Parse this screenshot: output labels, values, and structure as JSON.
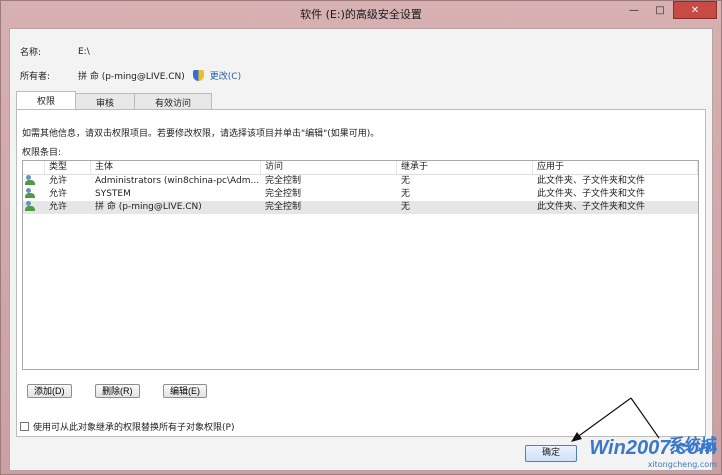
{
  "window": {
    "title": "软件 (E:)的高级安全设置",
    "controls": {
      "minimize": "—",
      "maximize": "□",
      "close": "✕"
    }
  },
  "info": {
    "name_label": "名称:",
    "name_value": "E:\\",
    "owner_label": "所有者:",
    "owner_value": "拼 命 (p-ming@LIVE.CN)",
    "change_link": "更改(C)"
  },
  "tabs": [
    {
      "label": "权限",
      "active": true
    },
    {
      "label": "审核",
      "active": false
    },
    {
      "label": "有效访问",
      "active": false
    }
  ],
  "panel": {
    "hint": "如需其他信息，请双击权限项目。若要修改权限，请选择该项目并单击\"编辑\"(如果可用)。",
    "entries_label": "权限条目:",
    "columns": [
      "类型",
      "主体",
      "访问",
      "继承于",
      "应用于"
    ],
    "rows": [
      {
        "type": "允许",
        "principal": "Administrators (win8china-pc\\Adm...",
        "access": "完全控制",
        "inherited": "无",
        "applies": "此文件夹、子文件夹和文件",
        "icon": "group-icon"
      },
      {
        "type": "允许",
        "principal": "SYSTEM",
        "access": "完全控制",
        "inherited": "无",
        "applies": "此文件夹、子文件夹和文件",
        "icon": "group-icon"
      },
      {
        "type": "允许",
        "principal": "拼 命 (p-ming@LIVE.CN)",
        "access": "完全控制",
        "inherited": "无",
        "applies": "此文件夹、子文件夹和文件",
        "icon": "user-icon"
      }
    ]
  },
  "buttons": {
    "add": "添加(D)",
    "remove": "删除(R)",
    "edit": "编辑(E)",
    "ok": "确定"
  },
  "checkbox": {
    "label": "使用可从此对象继承的权限替换所有子对象权限(P)",
    "checked": false
  },
  "watermark": {
    "main": "Win2007.com",
    "brand": "系统城",
    "sub": "xitongcheng.com"
  }
}
